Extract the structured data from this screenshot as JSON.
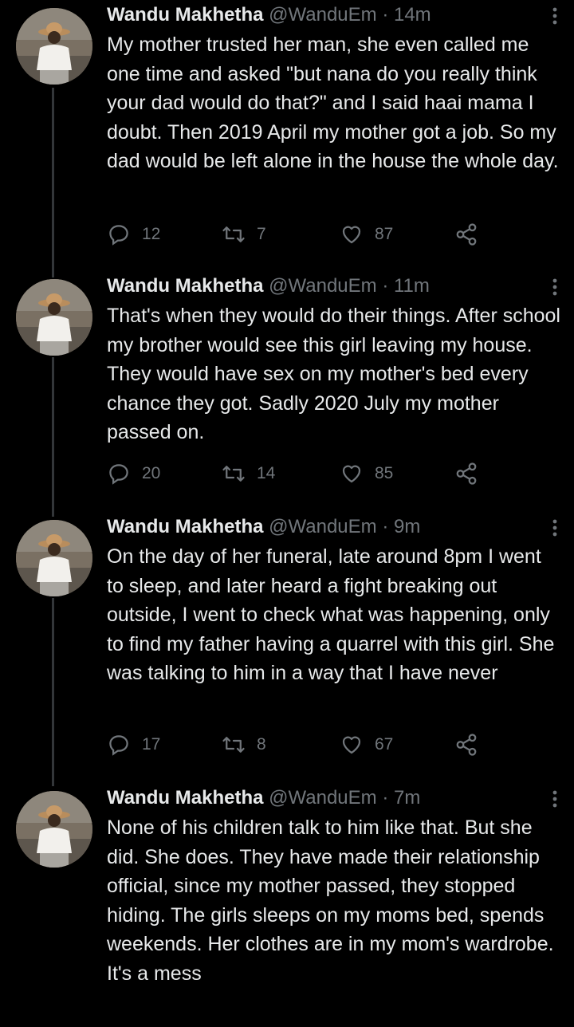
{
  "tweets": [
    {
      "name": "Wandu Makhetha",
      "handle": "@WanduEm",
      "dot": "·",
      "time": "14m",
      "text": "My mother trusted her man, she even called me one time and asked \"but nana do you really think your dad would do that?\" and I said haai mama I doubt. Then 2019 April my mother got a job. So my dad would be left alone in the house the whole day.",
      "replies": "12",
      "retweets": "7",
      "likes": "87"
    },
    {
      "name": "Wandu Makhetha",
      "handle": "@WanduEm",
      "dot": "·",
      "time": "11m",
      "text": "That's when they would do their things. After school my brother would see this girl leaving my house. They would have sex on my mother's bed every chance they got. Sadly 2020 July my mother passed on.",
      "replies": "20",
      "retweets": "14",
      "likes": "85"
    },
    {
      "name": "Wandu Makhetha",
      "handle": "@WanduEm",
      "dot": "·",
      "time": "9m",
      "text": "On the day of her funeral, late around 8pm I went to sleep, and later heard a fight breaking out outside, I went to check what was happening, only to find my father having a quarrel with this girl. She was talking to him in a way that I have never",
      "replies": "17",
      "retweets": "8",
      "likes": "67"
    },
    {
      "name": "Wandu Makhetha",
      "handle": "@WanduEm",
      "dot": "·",
      "time": "7m",
      "text": "None of his children talk to him like that. But she did. She does. They have made their relationship official, since my mother passed, they stopped hiding. The girls sleeps on my moms bed, spends weekends. Her clothes are in my mom's wardrobe. It's a mess",
      "replies": "",
      "retweets": "",
      "likes": ""
    }
  ],
  "icons": {
    "reply": "reply-icon",
    "retweet": "retweet-icon",
    "like": "heart-icon",
    "share": "share-icon",
    "more": "more-icon"
  },
  "colors": {
    "background": "#000000",
    "text": "#e7e9ea",
    "secondary": "#71767b",
    "thread_line": "#333639"
  }
}
